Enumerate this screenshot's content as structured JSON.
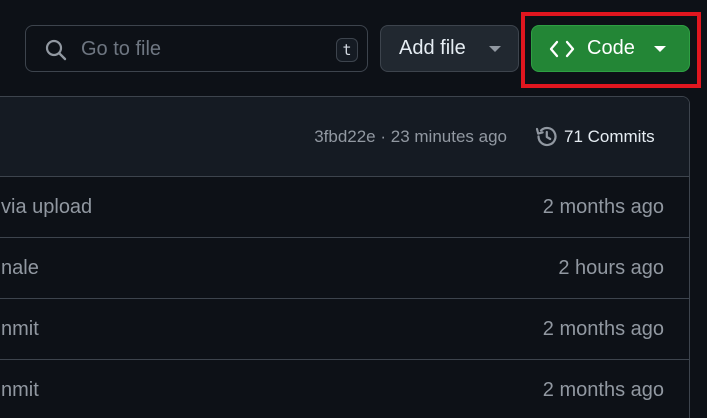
{
  "toolbar": {
    "search_placeholder": "Go to file",
    "search_shortcut": "t",
    "add_file_label": "Add file",
    "code_label": "Code"
  },
  "latest_commit": {
    "meta": "3fbd22e · 23 minutes ago",
    "commits_label": "71 Commits"
  },
  "rows": [
    {
      "message": "via upload",
      "time": "2 months ago"
    },
    {
      "message": "nale",
      "time": "2 hours ago"
    },
    {
      "message": "nmit",
      "time": "2 months ago"
    },
    {
      "message": "nmit",
      "time": "2 months ago"
    }
  ],
  "icons": {
    "search": "search-icon",
    "code": "code-icon",
    "history": "history-icon",
    "caret": "triangle-down-icon"
  },
  "colors": {
    "background": "#0d1117",
    "code_button": "#238636",
    "highlight": "#e0161f"
  }
}
